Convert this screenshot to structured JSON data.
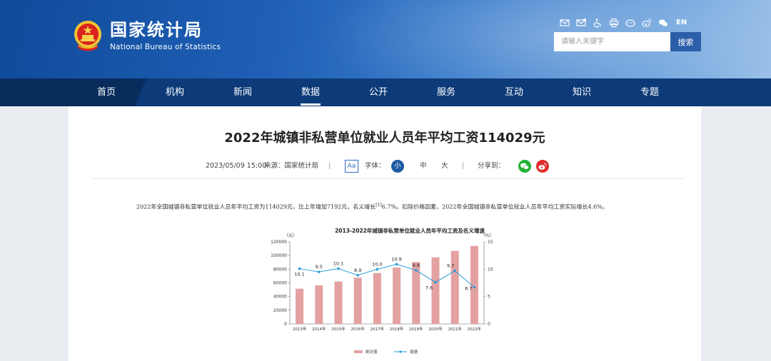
{
  "header": {
    "logo_cn": "国家统计局",
    "logo_en": "National Bureau of Statistics",
    "tools": [
      "mail-icon",
      "feedback-icon",
      "accessibility-icon",
      "print-icon",
      "weixin-icon",
      "weibo-icon",
      "chat-icon"
    ],
    "lang": "EN",
    "search_placeholder": "请输入关键字",
    "search_button": "搜索"
  },
  "nav": {
    "items": [
      "首页",
      "机构",
      "新闻",
      "数据",
      "公开",
      "服务",
      "互动",
      "知识",
      "专题"
    ],
    "active_index": 3
  },
  "article": {
    "title": "2022年城镇非私营单位就业人员年平均工资114029元",
    "date": "2023/05/09 15:00",
    "source": "来源：国家统计局",
    "font_icon": "Aa",
    "font_label": "字体：",
    "font_small": "小",
    "font_medium": "中",
    "font_large": "大",
    "share_label": "分享到：",
    "separator": "|",
    "paragraph_a": "2022年全国城镇非私营单位就业人员年平均工资为114029元，比上年增加7192元，名义增长",
    "paragraph_note": "[1]",
    "paragraph_b": "6.7%。扣除价格因素，2022年全国城镇非私营单位就业人员年平均工资实际增长4.6%。"
  },
  "colors": {
    "bar": "#e3a1a2",
    "line": "#2a9fd8",
    "nav_bg": "#0d3a78"
  },
  "chart_data": {
    "type": "bar",
    "title": "2013-2022年城镇非私营单位就业人员年平均工资及名义增速",
    "left_unit": "（元）",
    "right_unit": "（%）",
    "categories": [
      "2013年",
      "2014年",
      "2015年",
      "2016年",
      "2017年",
      "2018年",
      "2019年",
      "2020年",
      "2021年",
      "2022年"
    ],
    "series": [
      {
        "name": "绝对值",
        "type": "bar",
        "values": [
          51483,
          56360,
          62029,
          67569,
          74318,
          82413,
          90501,
          97379,
          106837,
          114029
        ]
      },
      {
        "name": "增速",
        "type": "line",
        "values": [
          10.1,
          9.5,
          10.1,
          8.9,
          10.0,
          10.9,
          9.8,
          7.6,
          9.7,
          6.7
        ]
      }
    ],
    "data_labels": [
      "10.1",
      "9.5",
      "10.1",
      "8.9",
      "10.0",
      "10.9",
      "9.8",
      "7.6",
      "9.7",
      "6.7"
    ],
    "y_left_ticks": [
      "0",
      "20000",
      "40000",
      "60000",
      "80000",
      "100000",
      "120000"
    ],
    "y_right_ticks": [
      "0",
      "5",
      "10",
      "15"
    ],
    "ylim_left": [
      0,
      120000
    ],
    "ylim_right": [
      0,
      15
    ],
    "legend_position": "bottom"
  }
}
